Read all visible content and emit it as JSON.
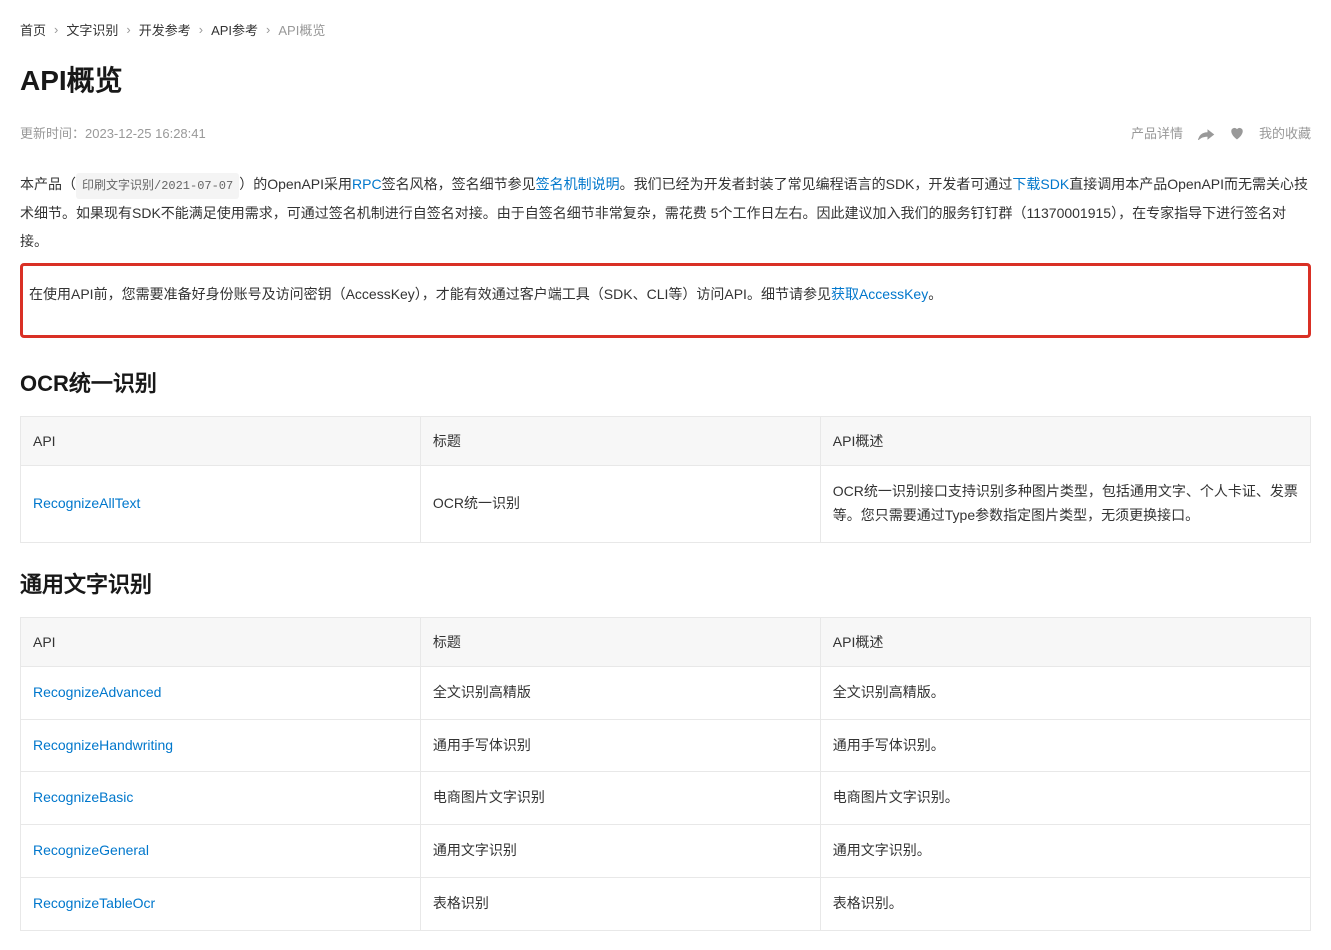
{
  "breadcrumb": {
    "items": [
      "首页",
      "文字识别",
      "开发参考",
      "API参考"
    ],
    "current": "API概览"
  },
  "page_title": "API概览",
  "update_time_label": "更新时间：",
  "update_time": "2023-12-25 16:28:41",
  "meta": {
    "product_detail": "产品详情",
    "my_favorite": "我的收藏"
  },
  "intro": {
    "prefix": "本产品（",
    "chip": "印刷文字识别/2021-07-07",
    "after_chip": "）的OpenAPI采用",
    "rpc_link": "RPC",
    "seg1": "签名风格，签名细节参见",
    "sign_link": "签名机制说明",
    "seg2": "。我们已经为开发者封装了常见编程语言的SDK，开发者可通过",
    "sdk_link": "下载SDK",
    "seg3": "直接调用本产品OpenAPI而无需关心技术细节。如果现有SDK不能满足使用需求，可通过签名机制进行自签名对接。由于自签名细节非常复杂，需花费 5个工作日左右。因此建议加入我们的服务钉钉群（11370001915），在专家指导下进行签名对接。"
  },
  "highlight": {
    "seg1": "在使用API前，您需要准备好身份账号及访问密钥（AccessKey），才能有效通过客户端工具（SDK、CLI等）访问API。细节请参见",
    "ak_link": "获取AccessKey",
    "seg2": "。"
  },
  "sections": [
    {
      "heading": "OCR统一识别",
      "headers": {
        "api": "API",
        "title": "标题",
        "desc": "API概述"
      },
      "rows": [
        {
          "api": "RecognizeAllText",
          "title": "OCR统一识别",
          "desc": "OCR统一识别接口支持识别多种图片类型，包括通用文字、个人卡证、发票等。您只需要通过Type参数指定图片类型，无须更换接口。"
        }
      ]
    },
    {
      "heading": "通用文字识别",
      "headers": {
        "api": "API",
        "title": "标题",
        "desc": "API概述"
      },
      "rows": [
        {
          "api": "RecognizeAdvanced",
          "title": "全文识别高精版",
          "desc": "全文识别高精版。"
        },
        {
          "api": "RecognizeHandwriting",
          "title": "通用手写体识别",
          "desc": "通用手写体识别。"
        },
        {
          "api": "RecognizeBasic",
          "title": "电商图片文字识别",
          "desc": "电商图片文字识别。"
        },
        {
          "api": "RecognizeGeneral",
          "title": "通用文字识别",
          "desc": "通用文字识别。"
        },
        {
          "api": "RecognizeTableOcr",
          "title": "表格识别",
          "desc": "表格识别。"
        }
      ]
    }
  ]
}
